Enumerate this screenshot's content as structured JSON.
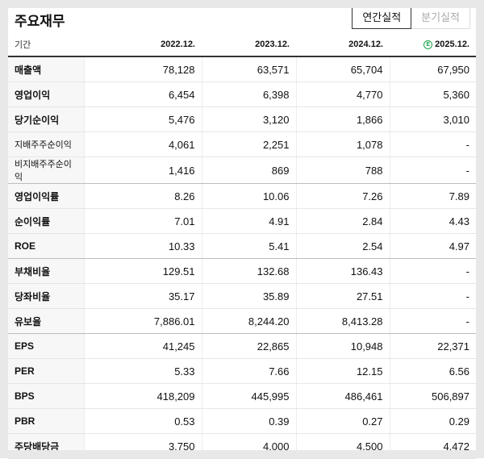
{
  "title": "주요재무",
  "buttons": {
    "annual": "연간실적",
    "quarterly": "분기실적"
  },
  "header": {
    "label": "기간",
    "periods": [
      "2022.12.",
      "2023.12.",
      "2024.12.",
      "2025.12."
    ]
  },
  "rows": [
    {
      "label": "매출액",
      "values": [
        "78,128",
        "63,571",
        "65,704",
        "67,950"
      ]
    },
    {
      "label": "영업이익",
      "values": [
        "6,454",
        "6,398",
        "4,770",
        "5,360"
      ]
    },
    {
      "label": "당기순이익",
      "values": [
        "5,476",
        "3,120",
        "1,866",
        "3,010"
      ]
    },
    {
      "label": "지배주주순이익",
      "values": [
        "4,061",
        "2,251",
        "1,078",
        "-"
      ]
    },
    {
      "label": "비지배주주순이익",
      "values": [
        "1,416",
        "869",
        "788",
        "-"
      ]
    },
    {
      "label": "영업이익률",
      "values": [
        "8.26",
        "10.06",
        "7.26",
        "7.89"
      ]
    },
    {
      "label": "순이익률",
      "values": [
        "7.01",
        "4.91",
        "2.84",
        "4.43"
      ]
    },
    {
      "label": "ROE",
      "values": [
        "10.33",
        "5.41",
        "2.54",
        "4.97"
      ]
    },
    {
      "label": "부채비율",
      "values": [
        "129.51",
        "132.68",
        "136.43",
        "-"
      ]
    },
    {
      "label": "당좌비율",
      "values": [
        "35.17",
        "35.89",
        "27.51",
        "-"
      ]
    },
    {
      "label": "유보율",
      "values": [
        "7,886.01",
        "8,244.20",
        "8,413.28",
        "-"
      ]
    },
    {
      "label": "EPS",
      "values": [
        "41,245",
        "22,865",
        "10,948",
        "22,371"
      ]
    },
    {
      "label": "PER",
      "values": [
        "5.33",
        "7.66",
        "12.15",
        "6.56"
      ]
    },
    {
      "label": "BPS",
      "values": [
        "418,209",
        "445,995",
        "486,461",
        "506,897"
      ]
    },
    {
      "label": "PBR",
      "values": [
        "0.53",
        "0.39",
        "0.27",
        "0.29"
      ]
    },
    {
      "label": "주당배당금",
      "values": [
        "3,750",
        "4,000",
        "4,500",
        "4,472"
      ]
    }
  ],
  "colors": {
    "estimate_icon": "#1aa34a",
    "accent_border": "#333333"
  },
  "estimate_icon": "estimate-circle-e-icon"
}
